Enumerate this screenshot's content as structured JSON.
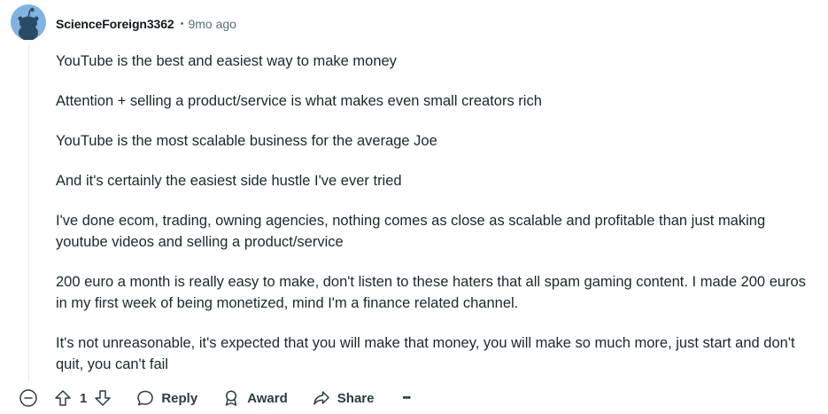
{
  "comment": {
    "username": "ScienceForeign3362",
    "separator": "•",
    "time_ago": "9mo ago",
    "paragraphs": [
      "YouTube is the best and easiest way to make money",
      "Attention + selling a product/service is what makes even small creators rich",
      "YouTube is the most scalable business for the average Joe",
      "And it's certainly the easiest side hustle I've ever tried",
      "I've done ecom, trading, owning agencies, nothing comes as close as scalable and profitable than just making youtube videos and selling a product/service",
      "200 euro a month is really easy to make, don't listen to these haters that all spam gaming content. I made 200 euros in my first week of being monetized, mind I'm a finance related channel.",
      "It's not unreasonable, it's expected that you will make that money, you will make so much more, just start and don't quit, you can't fail"
    ]
  },
  "actions": {
    "vote_count": "1",
    "reply_label": "Reply",
    "award_label": "Award",
    "share_label": "Share",
    "more_label": "•••"
  },
  "colors": {
    "avatar_bg": "#7fb3e0",
    "meta_text": "#576f76",
    "body_text": "#1a282d",
    "thread_line": "#e5ebee"
  },
  "icons": {
    "avatar": "snoo-avatar-icon",
    "collapse": "collapse-minus-icon",
    "upvote": "upvote-arrow-icon",
    "downvote": "downvote-arrow-icon",
    "reply": "speech-bubble-icon",
    "award": "award-ribbon-icon",
    "share": "share-arrow-icon",
    "more": "more-dots-icon"
  }
}
